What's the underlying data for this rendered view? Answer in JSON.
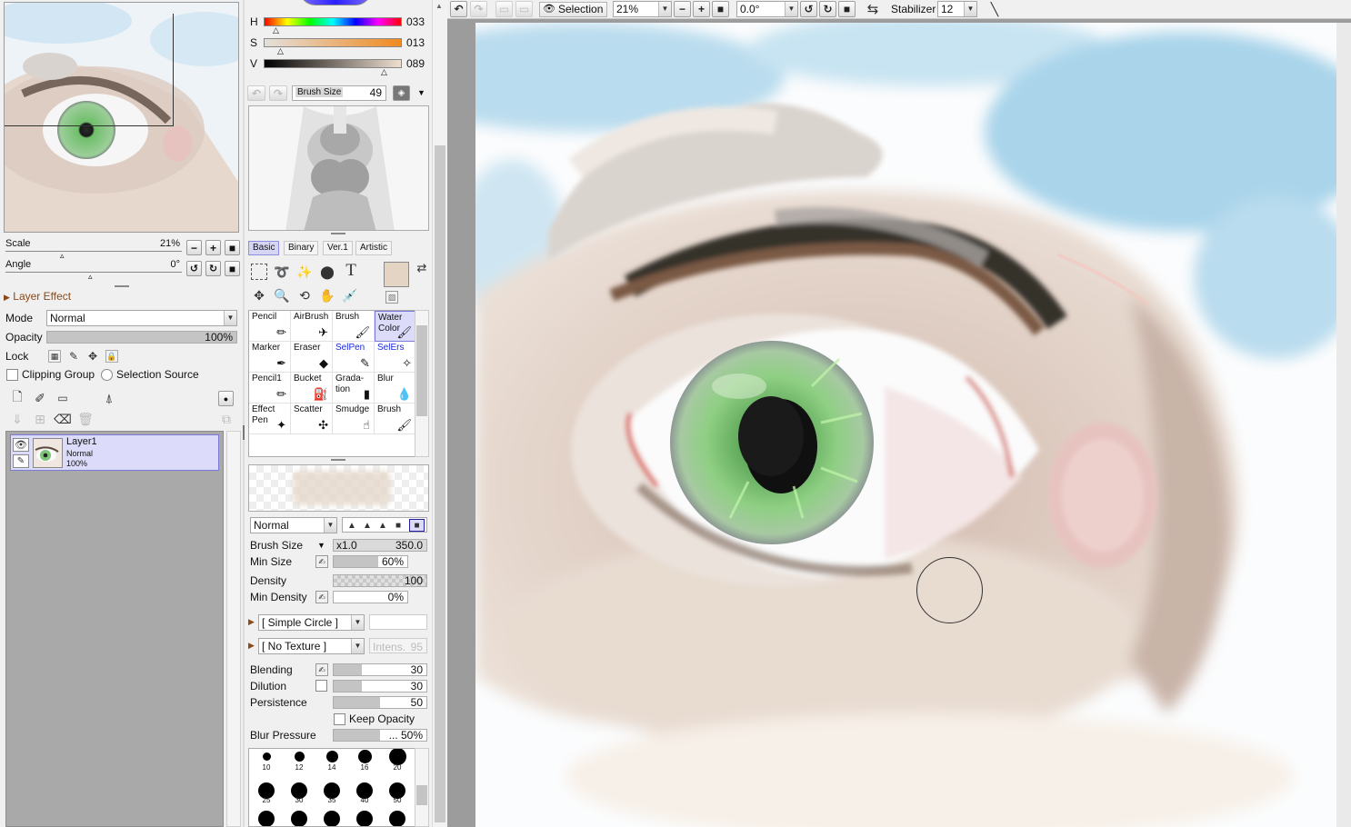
{
  "colors": {
    "panel_bg": "#f0f0f0",
    "selection_highlight": "#dcdcfa",
    "canvas_frame": "#9c9c9c",
    "iris_green": "#6fbf6a",
    "sky_blue": "#a9d4ea",
    "skin": "#e3d3c7",
    "foreground_color": "#e4d4c4"
  },
  "navigator": {
    "scale_label": "Scale",
    "scale_value": "21%",
    "angle_label": "Angle",
    "angle_value": "0°"
  },
  "layer_panel": {
    "section_title": "Layer Effect",
    "mode_label": "Mode",
    "mode_value": "Normal",
    "opacity_label": "Opacity",
    "opacity_value": "100%",
    "opacity_level": 1.0,
    "lock_label": "Lock",
    "clipping_group_label": "Clipping Group",
    "selection_source_label": "Selection Source",
    "layers": [
      {
        "name": "Layer1",
        "mode": "Normal",
        "opacity": "100%"
      }
    ]
  },
  "color_sliders": {
    "h_label": "H",
    "h_value": "033",
    "s_label": "S",
    "s_value": "013",
    "v_label": "V",
    "v_value": "089"
  },
  "brush_header": {
    "label": "Brush Size",
    "value": "49"
  },
  "tool_tabs": [
    "Basic",
    "Binary",
    "Ver.1",
    "Artistic"
  ],
  "tools": [
    {
      "name": "Pencil",
      "label": "Pencil",
      "icon": "pencil-icon",
      "blue": false
    },
    {
      "name": "AirBrush",
      "label": "AirBrush",
      "icon": "airbrush-icon",
      "blue": false
    },
    {
      "name": "Brush",
      "label": "Brush",
      "icon": "brush-icon",
      "blue": false
    },
    {
      "name": "WaterColor",
      "label": "Water\nColor",
      "icon": "watercolor-icon",
      "blue": false
    },
    {
      "name": "Marker",
      "label": "Marker",
      "icon": "marker-icon",
      "blue": false
    },
    {
      "name": "Eraser",
      "label": "Eraser",
      "icon": "eraser-icon",
      "blue": false
    },
    {
      "name": "SelPen",
      "label": "SelPen",
      "icon": "selpen-icon",
      "blue": true
    },
    {
      "name": "SelErs",
      "label": "SelErs",
      "icon": "selers-icon",
      "blue": true
    },
    {
      "name": "Pencil1",
      "label": "Pencil1",
      "icon": "pencil-icon",
      "blue": false
    },
    {
      "name": "Bucket",
      "label": "Bucket",
      "icon": "bucket-icon",
      "blue": false
    },
    {
      "name": "Gradation",
      "label": "Grada-\ntion",
      "icon": "gradation-icon",
      "blue": false
    },
    {
      "name": "Blur",
      "label": "Blur",
      "icon": "blur-icon",
      "blue": false
    },
    {
      "name": "EffectPen",
      "label": "Effect\nPen",
      "icon": "effectpen-icon",
      "blue": false
    },
    {
      "name": "Scatter",
      "label": "Scatter",
      "icon": "scatter-icon",
      "blue": false
    },
    {
      "name": "Smudge",
      "label": "Smudge",
      "icon": "smudge-icon",
      "blue": false
    },
    {
      "name": "Brush2",
      "label": "Brush",
      "icon": "brush-icon",
      "blue": false
    }
  ],
  "brush_settings": {
    "blend_mode": "Normal",
    "brush_size_label": "Brush Size",
    "brush_size_mult": "x1.0",
    "brush_size_value": "350.0",
    "min_size_label": "Min Size",
    "min_size_value": "60%",
    "min_size_level": 0.6,
    "density_label": "Density",
    "density_value": "100",
    "min_density_label": "Min Density",
    "min_density_value": "0%",
    "shape_value": "[ Simple Circle ]",
    "texture_value": "[ No Texture ]",
    "texture_intensity_label": "Intens.",
    "texture_intensity_value": "95",
    "blending_label": "Blending",
    "blending_value": "30",
    "blending_level": 0.3,
    "dilution_label": "Dilution",
    "dilution_value": "30",
    "dilution_level": 0.3,
    "persistence_label": "Persistence",
    "persistence_value": "50",
    "persistence_level": 0.5,
    "keep_opacity_label": "Keep Opacity",
    "blur_pressure_label": "Blur Pressure",
    "blur_pressure_value": "... 50%",
    "blur_pressure_level": 0.5
  },
  "brush_dots": [
    "10",
    "12",
    "14",
    "16",
    "20",
    "25",
    "30",
    "35",
    "40",
    "50"
  ],
  "toolbar": {
    "selection_label": "Selection",
    "zoom_value": "21%",
    "angle_value": "0.0°",
    "stabilizer_label": "Stabilizer",
    "stabilizer_value": "12"
  }
}
